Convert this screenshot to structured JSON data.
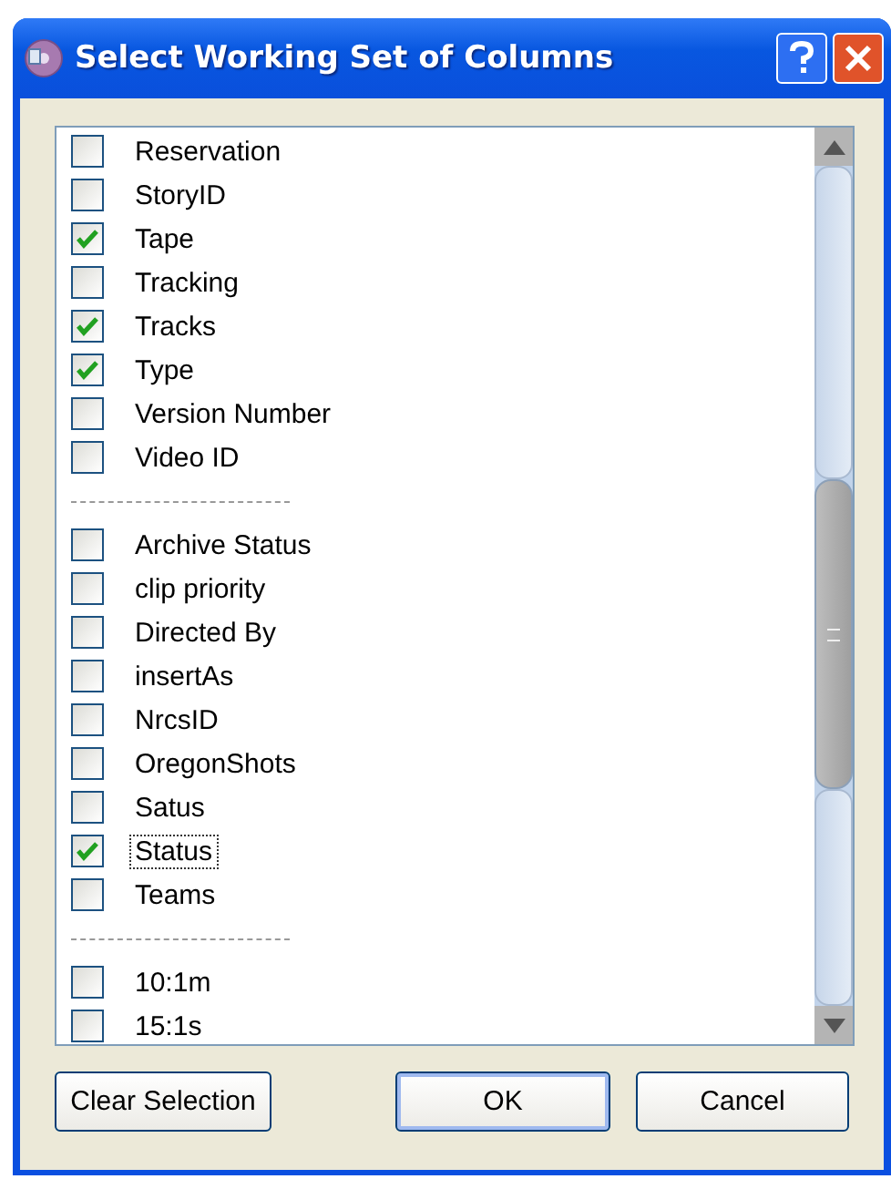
{
  "window": {
    "title": "Select Working Set of Columns"
  },
  "items": [
    {
      "kind": "item",
      "label": "Reservation",
      "checked": false,
      "focused": false
    },
    {
      "kind": "item",
      "label": "StoryID",
      "checked": false,
      "focused": false
    },
    {
      "kind": "item",
      "label": "Tape",
      "checked": true,
      "focused": false
    },
    {
      "kind": "item",
      "label": "Tracking",
      "checked": false,
      "focused": false
    },
    {
      "kind": "item",
      "label": "Tracks",
      "checked": true,
      "focused": false
    },
    {
      "kind": "item",
      "label": "Type",
      "checked": true,
      "focused": false
    },
    {
      "kind": "item",
      "label": "Version Number",
      "checked": false,
      "focused": false
    },
    {
      "kind": "item",
      "label": "Video ID",
      "checked": false,
      "focused": false
    },
    {
      "kind": "separator"
    },
    {
      "kind": "item",
      "label": "Archive Status",
      "checked": false,
      "focused": false
    },
    {
      "kind": "item",
      "label": "clip priority",
      "checked": false,
      "focused": false
    },
    {
      "kind": "item",
      "label": "Directed By",
      "checked": false,
      "focused": false
    },
    {
      "kind": "item",
      "label": "insertAs",
      "checked": false,
      "focused": false
    },
    {
      "kind": "item",
      "label": "NrcsID",
      "checked": false,
      "focused": false
    },
    {
      "kind": "item",
      "label": "OregonShots",
      "checked": false,
      "focused": false
    },
    {
      "kind": "item",
      "label": "Satus",
      "checked": false,
      "focused": false
    },
    {
      "kind": "item",
      "label": "Status",
      "checked": true,
      "focused": true
    },
    {
      "kind": "item",
      "label": "Teams",
      "checked": false,
      "focused": false
    },
    {
      "kind": "separator"
    },
    {
      "kind": "item",
      "label": "10:1m",
      "checked": false,
      "focused": false
    },
    {
      "kind": "item",
      "label": "15:1s",
      "checked": false,
      "focused": false
    }
  ],
  "buttons": [
    {
      "label": "Clear Selection",
      "default": false
    },
    {
      "label": "OK",
      "default": true
    },
    {
      "label": "Cancel",
      "default": false
    }
  ]
}
